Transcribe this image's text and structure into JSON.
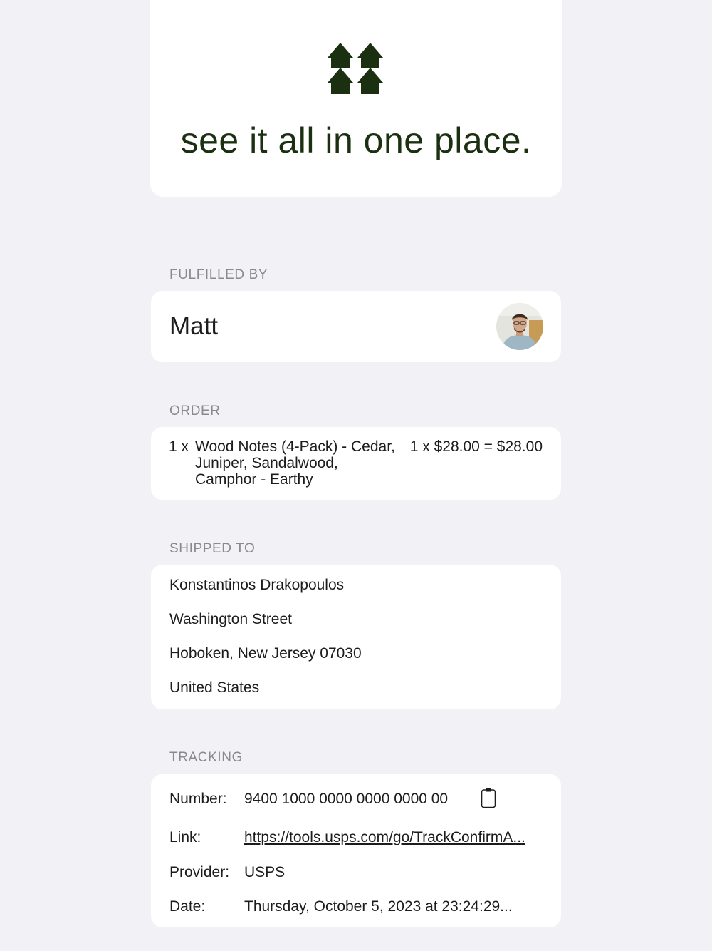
{
  "hero": {
    "logo_icon": "four-houses-logo",
    "tagline": "see it all in one place.",
    "color": "#1a3010"
  },
  "fulfilled": {
    "label": "FULFILLED BY",
    "name": "Matt",
    "avatar_icon": "person-avatar"
  },
  "order": {
    "label": "ORDER",
    "quantity": "1 x",
    "item": "Wood Notes (4-Pack) - Cedar, Juniper, Sandalwood, Camphor - Earthy",
    "price": "1 x $28.00 = $28.00"
  },
  "shipped": {
    "label": "SHIPPED TO",
    "lines": [
      "Konstantinos Drakopoulos",
      "Washington Street",
      "Hoboken, New Jersey 07030",
      "United States"
    ]
  },
  "tracking": {
    "label": "TRACKING",
    "number_key": "Number:",
    "number_value": "9400 1000 0000 0000 0000 00",
    "copy_icon": "clipboard-icon",
    "link_key": "Link:",
    "link_value": "https://tools.usps.com/go/TrackConfirmA...",
    "provider_key": "Provider:",
    "provider_value": "USPS",
    "date_key": "Date:",
    "date_value": "Thursday, October 5, 2023 at 23:24:29..."
  }
}
